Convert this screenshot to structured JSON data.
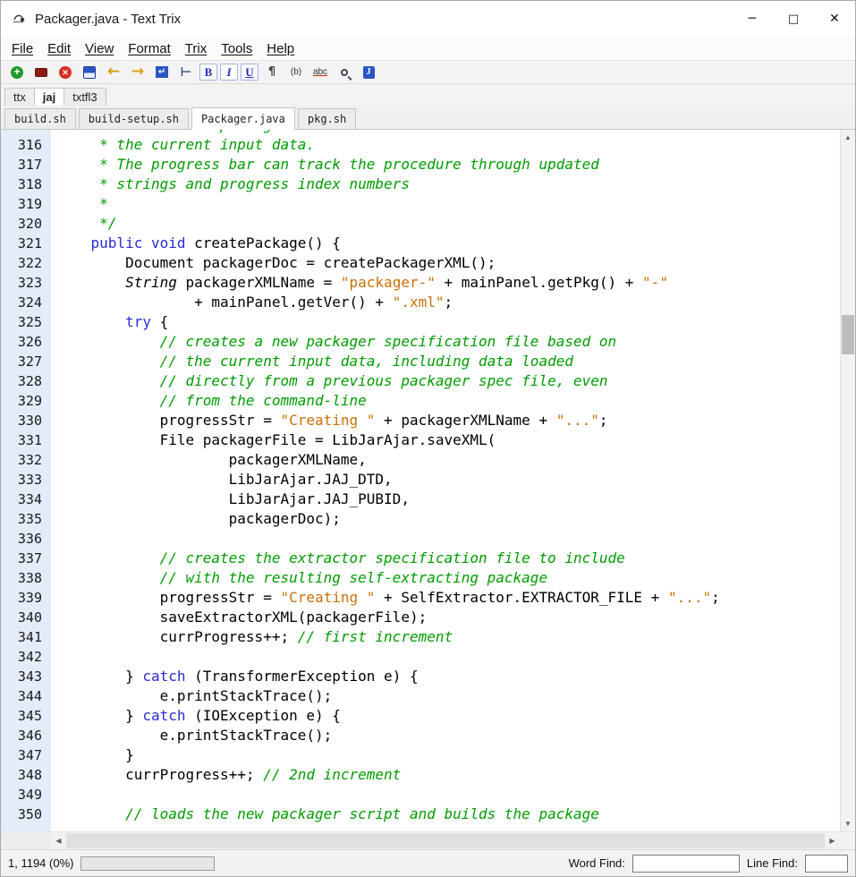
{
  "window": {
    "title": "Packager.java - Text Trix",
    "minimize_glyph": "─",
    "maximize_glyph": "□",
    "close_glyph": "✕"
  },
  "menu": {
    "items": [
      "File",
      "Edit",
      "View",
      "Format",
      "Trix",
      "Tools",
      "Help"
    ]
  },
  "toolbar": {
    "buttons": [
      {
        "name": "new-file",
        "glyph": "+"
      },
      {
        "name": "open-file",
        "glyph": ""
      },
      {
        "name": "close-file",
        "glyph": "✕"
      },
      {
        "name": "save-file",
        "glyph": ""
      },
      {
        "name": "undo",
        "glyph": "←"
      },
      {
        "name": "redo",
        "glyph": "→"
      },
      {
        "name": "line-wrap",
        "glyph": "↵"
      },
      {
        "name": "tab-stop",
        "glyph": "⊢"
      },
      {
        "name": "bold",
        "glyph": "B"
      },
      {
        "name": "italic",
        "glyph": "I"
      },
      {
        "name": "underline",
        "glyph": "U"
      },
      {
        "name": "paragraph-marks",
        "glyph": "¶"
      },
      {
        "name": "bold-b",
        "glyph": "(b)"
      },
      {
        "name": "spell-check",
        "glyph": "abc"
      },
      {
        "name": "search",
        "glyph": ""
      },
      {
        "name": "trix-note",
        "glyph": "J"
      }
    ]
  },
  "group_tabs": [
    {
      "label": "ttx",
      "active": false
    },
    {
      "label": "jaj",
      "active": true
    },
    {
      "label": "txtfl3",
      "active": false
    }
  ],
  "file_tabs": [
    {
      "label": "build.sh",
      "active": false
    },
    {
      "label": "build-setup.sh",
      "active": false
    },
    {
      "label": "Packager.java",
      "active": true
    },
    {
      "label": "pkg.sh",
      "active": false
    }
  ],
  "editor": {
    "colors": {
      "comment": "#009b00",
      "keyword": "#2b2bd0",
      "string": "#c8700a",
      "gutter_bg": "#e2edf9"
    },
    "lines": [
      {
        "n": "315",
        "partial": true,
        "s": [
          {
            "t": "c",
            "x": "     * Creates the package based on"
          }
        ]
      },
      {
        "n": "316",
        "s": [
          {
            "t": "c",
            "x": "     * the current input data."
          }
        ]
      },
      {
        "n": "317",
        "s": [
          {
            "t": "c",
            "x": "     * The progress bar can track the procedure through updated"
          }
        ]
      },
      {
        "n": "318",
        "s": [
          {
            "t": "c",
            "x": "     * strings and progress index numbers"
          }
        ]
      },
      {
        "n": "319",
        "s": [
          {
            "t": "c",
            "x": "     *"
          }
        ]
      },
      {
        "n": "320",
        "s": [
          {
            "t": "c",
            "x": "     */"
          }
        ]
      },
      {
        "n": "321",
        "s": [
          {
            "t": "p",
            "x": "    "
          },
          {
            "t": "k",
            "x": "public"
          },
          {
            "t": "p",
            "x": " "
          },
          {
            "t": "k",
            "x": "void"
          },
          {
            "t": "p",
            "x": " createPackage() {"
          }
        ]
      },
      {
        "n": "322",
        "s": [
          {
            "t": "p",
            "x": "        Document packagerDoc = createPackagerXML();"
          }
        ]
      },
      {
        "n": "323",
        "s": [
          {
            "t": "p",
            "x": "        "
          },
          {
            "t": "i",
            "x": "String"
          },
          {
            "t": "p",
            "x": " packagerXMLName = "
          },
          {
            "t": "s",
            "x": "\"packager-\""
          },
          {
            "t": "p",
            "x": " + mainPanel.getPkg() + "
          },
          {
            "t": "s",
            "x": "\"-\""
          }
        ]
      },
      {
        "n": "324",
        "s": [
          {
            "t": "p",
            "x": "                + mainPanel.getVer() + "
          },
          {
            "t": "s",
            "x": "\".xml\""
          },
          {
            "t": "p",
            "x": ";"
          }
        ]
      },
      {
        "n": "325",
        "s": [
          {
            "t": "p",
            "x": "        "
          },
          {
            "t": "k",
            "x": "try"
          },
          {
            "t": "p",
            "x": " {"
          }
        ]
      },
      {
        "n": "326",
        "s": [
          {
            "t": "p",
            "x": "            "
          },
          {
            "t": "c",
            "x": "// creates a new packager specification file based on"
          }
        ]
      },
      {
        "n": "327",
        "s": [
          {
            "t": "p",
            "x": "            "
          },
          {
            "t": "c",
            "x": "// the current input data, including data loaded"
          }
        ]
      },
      {
        "n": "328",
        "s": [
          {
            "t": "p",
            "x": "            "
          },
          {
            "t": "c",
            "x": "// directly from a previous packager spec file, even"
          }
        ]
      },
      {
        "n": "329",
        "s": [
          {
            "t": "p",
            "x": "            "
          },
          {
            "t": "c",
            "x": "// from the command-line"
          }
        ]
      },
      {
        "n": "330",
        "s": [
          {
            "t": "p",
            "x": "            progressStr = "
          },
          {
            "t": "s",
            "x": "\"Creating \""
          },
          {
            "t": "p",
            "x": " + packagerXMLName + "
          },
          {
            "t": "s",
            "x": "\"...\""
          },
          {
            "t": "p",
            "x": ";"
          }
        ]
      },
      {
        "n": "331",
        "s": [
          {
            "t": "p",
            "x": "            File packagerFile = LibJarAjar.saveXML("
          }
        ]
      },
      {
        "n": "332",
        "s": [
          {
            "t": "p",
            "x": "                    packagerXMLName,"
          }
        ]
      },
      {
        "n": "333",
        "s": [
          {
            "t": "p",
            "x": "                    LibJarAjar.JAJ_DTD,"
          }
        ]
      },
      {
        "n": "334",
        "s": [
          {
            "t": "p",
            "x": "                    LibJarAjar.JAJ_PUBID,"
          }
        ]
      },
      {
        "n": "335",
        "s": [
          {
            "t": "p",
            "x": "                    packagerDoc);"
          }
        ]
      },
      {
        "n": "336",
        "s": []
      },
      {
        "n": "337",
        "s": [
          {
            "t": "p",
            "x": "            "
          },
          {
            "t": "c",
            "x": "// creates the extractor specification file to include"
          }
        ]
      },
      {
        "n": "338",
        "s": [
          {
            "t": "p",
            "x": "            "
          },
          {
            "t": "c",
            "x": "// with the resulting self-extracting package"
          }
        ]
      },
      {
        "n": "339",
        "s": [
          {
            "t": "p",
            "x": "            progressStr = "
          },
          {
            "t": "s",
            "x": "\"Creating \""
          },
          {
            "t": "p",
            "x": " + SelfExtractor.EXTRACTOR_FILE + "
          },
          {
            "t": "s",
            "x": "\"...\""
          },
          {
            "t": "p",
            "x": ";"
          }
        ]
      },
      {
        "n": "340",
        "s": [
          {
            "t": "p",
            "x": "            saveExtractorXML(packagerFile);"
          }
        ]
      },
      {
        "n": "341",
        "s": [
          {
            "t": "p",
            "x": "            currProgress++; "
          },
          {
            "t": "c",
            "x": "// first increment"
          }
        ]
      },
      {
        "n": "342",
        "s": []
      },
      {
        "n": "343",
        "s": [
          {
            "t": "p",
            "x": "        } "
          },
          {
            "t": "k",
            "x": "catch"
          },
          {
            "t": "p",
            "x": " (TransformerException e) {"
          }
        ]
      },
      {
        "n": "344",
        "s": [
          {
            "t": "p",
            "x": "            e.printStackTrace();"
          }
        ]
      },
      {
        "n": "345",
        "s": [
          {
            "t": "p",
            "x": "        } "
          },
          {
            "t": "k",
            "x": "catch"
          },
          {
            "t": "p",
            "x": " (IOException e) {"
          }
        ]
      },
      {
        "n": "346",
        "s": [
          {
            "t": "p",
            "x": "            e.printStackTrace();"
          }
        ]
      },
      {
        "n": "347",
        "s": [
          {
            "t": "p",
            "x": "        }"
          }
        ]
      },
      {
        "n": "348",
        "s": [
          {
            "t": "p",
            "x": "        currProgress++; "
          },
          {
            "t": "c",
            "x": "// 2nd increment"
          }
        ]
      },
      {
        "n": "349",
        "s": []
      },
      {
        "n": "350",
        "s": [
          {
            "t": "p",
            "x": "        "
          },
          {
            "t": "c",
            "x": "// loads the new packager script and builds the package"
          }
        ]
      }
    ]
  },
  "scrollbars": {
    "up": "▲",
    "down": "▼",
    "left": "◀",
    "right": "▶"
  },
  "status": {
    "position": "1, 1194 (0%)",
    "word_find_label": "Word Find:",
    "word_find_value": "",
    "line_find_label": "Line Find:",
    "line_find_value": ""
  }
}
